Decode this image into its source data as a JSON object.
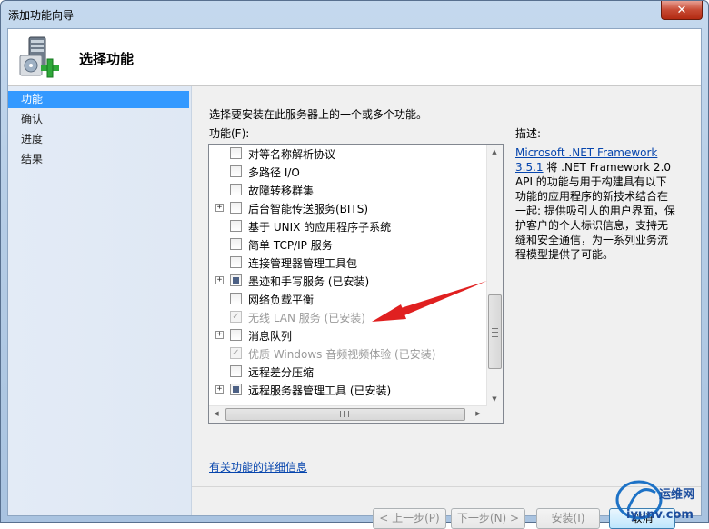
{
  "window": {
    "title": "添加功能向导",
    "close_glyph": "✕"
  },
  "header": {
    "title": "选择功能",
    "icon": "server-add-icon"
  },
  "nav": {
    "items": [
      {
        "label": "功能",
        "active": true
      },
      {
        "label": "确认",
        "active": false
      },
      {
        "label": "进度",
        "active": false
      },
      {
        "label": "结果",
        "active": false
      }
    ]
  },
  "main": {
    "instruction": "选择要安装在此服务器上的一个或多个功能。",
    "features_label": "功能(F):",
    "description_label": "描述:",
    "description_link": "Microsoft .NET Framework 3.5.1",
    "description_text": " 将 .NET Framework 2.0 API 的功能与用于构建具有以下功能的应用程序的新技术结合在一起: 提供吸引人的用户界面，保护客户的个人标识信息，支持无缝和安全通信，为一系列业务流程模型提供了可能。",
    "more_info_link": "有关功能的详细信息"
  },
  "features": [
    {
      "label": "对等名称解析协议",
      "expandable": false,
      "state": "unchecked",
      "disabled": false
    },
    {
      "label": "多路径 I/O",
      "expandable": false,
      "state": "unchecked",
      "disabled": false
    },
    {
      "label": "故障转移群集",
      "expandable": false,
      "state": "unchecked",
      "disabled": false
    },
    {
      "label": "后台智能传送服务(BITS)",
      "expandable": true,
      "state": "unchecked",
      "disabled": false
    },
    {
      "label": "基于 UNIX 的应用程序子系统",
      "expandable": false,
      "state": "unchecked",
      "disabled": false
    },
    {
      "label": "简单 TCP/IP 服务",
      "expandable": false,
      "state": "unchecked",
      "disabled": false
    },
    {
      "label": "连接管理器管理工具包",
      "expandable": false,
      "state": "unchecked",
      "disabled": false
    },
    {
      "label": "墨迹和手写服务  (已安装)",
      "expandable": true,
      "state": "partial",
      "disabled": false
    },
    {
      "label": "网络负载平衡",
      "expandable": false,
      "state": "unchecked",
      "disabled": false
    },
    {
      "label": "无线 LAN 服务  (已安装)",
      "expandable": false,
      "state": "checked",
      "disabled": true
    },
    {
      "label": "消息队列",
      "expandable": true,
      "state": "unchecked",
      "disabled": false
    },
    {
      "label": "优质 Windows 音频视频体验  (已安装)",
      "expandable": false,
      "state": "checked",
      "disabled": true
    },
    {
      "label": "远程差分压缩",
      "expandable": false,
      "state": "unchecked",
      "disabled": false
    },
    {
      "label": "远程服务器管理工具  (已安装)",
      "expandable": true,
      "state": "partial",
      "disabled": false
    }
  ],
  "buttons": {
    "prev": "< 上一步(P)",
    "next": "下一步(N) >",
    "install": "安装(I)",
    "cancel": "取消"
  },
  "watermark": {
    "site": "iyunv.com",
    "brand": "运维网"
  },
  "colors": {
    "nav_active": "#3399ff",
    "annotation_arrow": "#e02020",
    "link": "#0645ad"
  }
}
